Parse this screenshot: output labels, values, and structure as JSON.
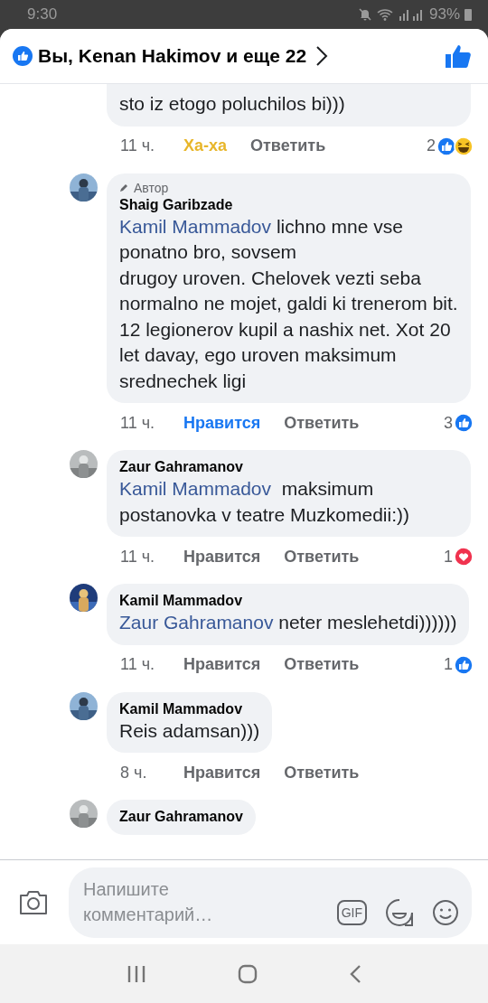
{
  "status_bar": {
    "time": "9:30",
    "battery": "93%"
  },
  "header": {
    "title": "Вы, Kenan Hakimov и еще 22",
    "liked": true
  },
  "comments": [
    {
      "partial_top": true,
      "text": "sto iz etogo poluchilos bi)))",
      "time": "11 ч.",
      "reaction": {
        "label": "Ха-ха",
        "kind": "haha"
      },
      "reply_label": "Ответить",
      "count": "2",
      "reactions": [
        {
          "kind": "like"
        },
        {
          "kind": "haha"
        }
      ]
    },
    {
      "partial_top": false,
      "avatar": {
        "kind": "picture"
      },
      "badge": "Автор",
      "name": "Shaig Garibzade",
      "mention": "Kamil Mammadov",
      "text": " lichno mne vse ponatno bro, sovsem\ndrugoy uroven. Chelovek vezti seba normalno ne mojet, galdi ki trenerom bit. 12 legionerov kupil a nashix net. Xot 20 let davay, ego uroven maksimum srednechek ligi",
      "time": "11 ч.",
      "reaction": {
        "label": "Нравится",
        "kind": "like"
      },
      "reply_label": "Ответить",
      "count": "3",
      "reactions": [
        {
          "kind": "like"
        }
      ]
    },
    {
      "partial_top": false,
      "avatar": {
        "kind": "picture"
      },
      "name": "Zaur Gahramanov",
      "mention": "Kamil Mammadov",
      "text": "  maksimum postanovka v teatre Muzkomedii:))",
      "time": "11 ч.",
      "reaction": {
        "label": "Нравится",
        "kind": "none"
      },
      "reply_label": "Ответить",
      "count": "1",
      "reactions": [
        {
          "kind": "love"
        }
      ]
    },
    {
      "partial_top": false,
      "avatar": {
        "kind": "picture"
      },
      "name": "Kamil Mammadov",
      "mention": "Zaur Gahramanov",
      "text": " neter meslehetdi))))))",
      "time": "11 ч.",
      "reaction": {
        "label": "Нравится",
        "kind": "none"
      },
      "reply_label": "Ответить",
      "count": "1",
      "reactions": [
        {
          "kind": "like"
        }
      ]
    },
    {
      "partial_top": false,
      "avatar": {
        "kind": "picture"
      },
      "name": "Kamil Mammadov",
      "text": "Reis adamsan)))",
      "time": "8 ч.",
      "reaction": {
        "label": "Нравится",
        "kind": "none"
      },
      "reply_label": "Ответить"
    },
    {
      "partial_top": false,
      "avatar": {
        "kind": "picture"
      },
      "name": "Zaur Gahramanov"
    }
  ],
  "composer": {
    "placeholder": "Напишите комментарий…",
    "gif_label": "GIF"
  }
}
